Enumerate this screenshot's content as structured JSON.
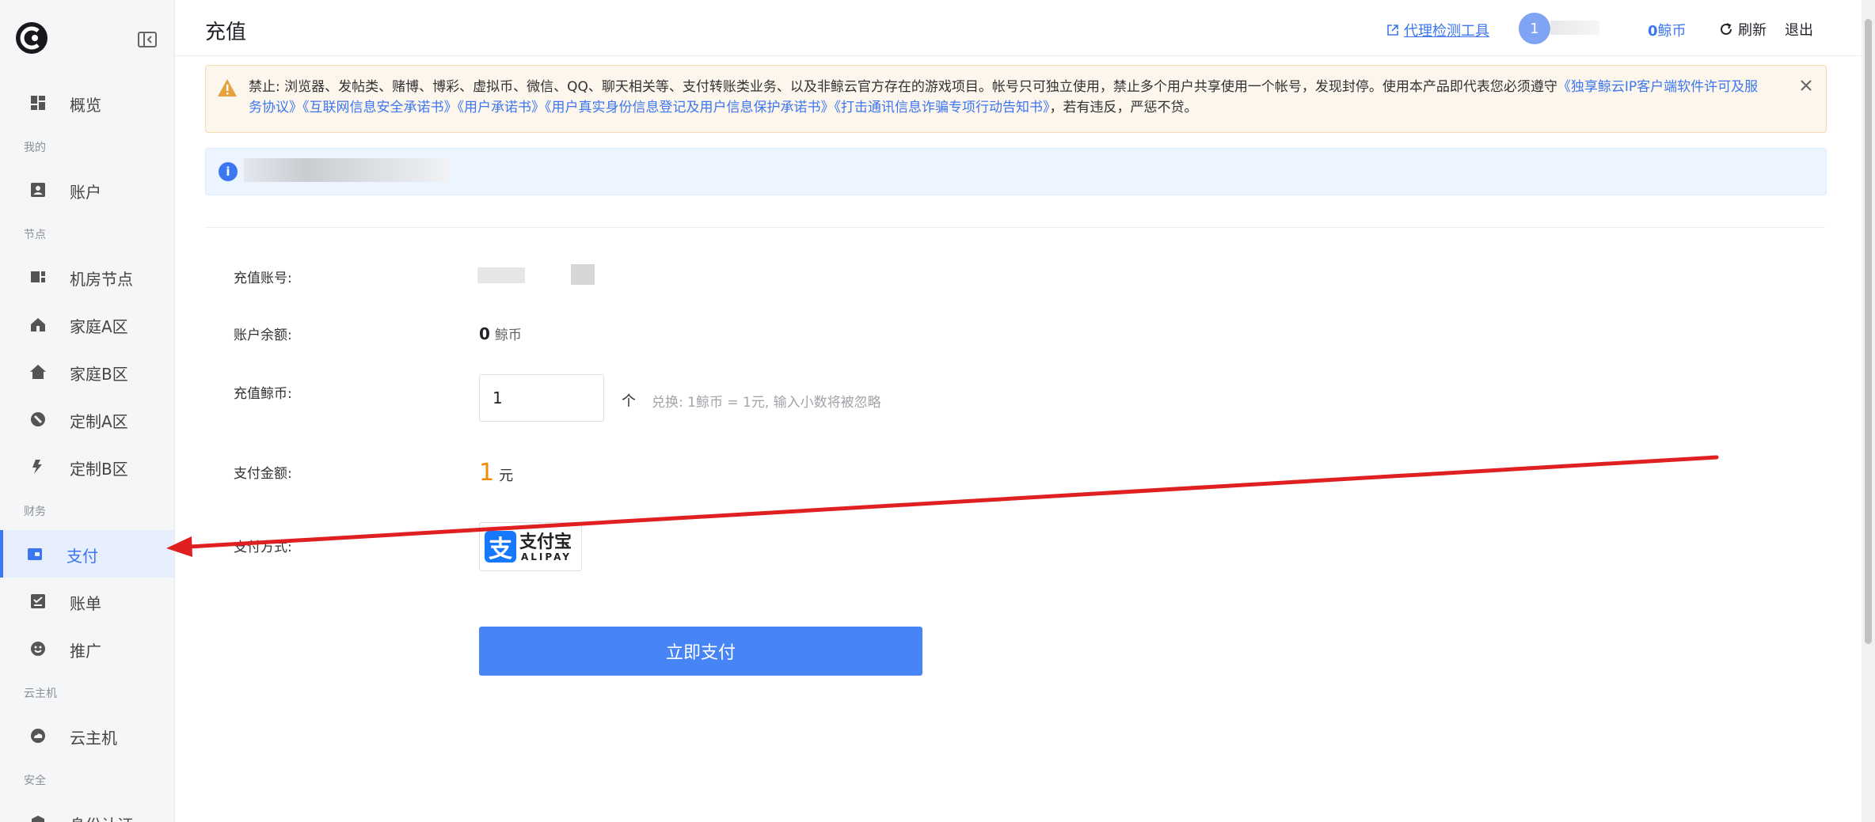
{
  "sidebar": {
    "items": [
      {
        "label": "概览",
        "icon": "dashboard-icon"
      },
      {
        "label": "账户",
        "icon": "account-icon"
      },
      {
        "label": "机房节点",
        "icon": "server-node-icon"
      },
      {
        "label": "家庭A区",
        "icon": "home-a-icon"
      },
      {
        "label": "家庭B区",
        "icon": "home-b-icon"
      },
      {
        "label": "定制A区",
        "icon": "custom-a-icon"
      },
      {
        "label": "定制B区",
        "icon": "custom-b-icon"
      },
      {
        "label": "支付",
        "icon": "wallet-icon"
      },
      {
        "label": "账单",
        "icon": "bill-icon"
      },
      {
        "label": "推广",
        "icon": "promote-icon"
      },
      {
        "label": "云主机",
        "icon": "cloud-icon"
      },
      {
        "label": "身份认证",
        "icon": "identity-icon"
      }
    ],
    "sections": [
      "我的",
      "节点",
      "财务",
      "云主机",
      "安全"
    ],
    "active_item": "支付"
  },
  "header": {
    "title": "充值",
    "proxy_tool": "代理检测工具",
    "avatar_text": "1",
    "balance_num": "0",
    "balance_unit": "鲸币",
    "refresh": "刷新",
    "logout": "退出"
  },
  "notice": {
    "text1": "禁止: 浏览器、发帖类、赌博、博彩、虚拟币、微信、QQ、聊天相关等、支付转账类业务、以及非鲸云官方存在的游戏项目。帐号只可独立使用，禁止多个用户共享使用一个帐号，发现封停。使用本产品即代表您必须遵守",
    "link1": "《独享鲸云IP客户端软件许可及服务协议》",
    "link2": "《互联网信息安全承诺书》",
    "link3": "《用户承诺书》",
    "link4": "《用户真实身份信息登记及用户信息保护承诺书》",
    "link5": "《打击通讯信息诈骗专项行动告知书》",
    "text2": "，若有违反，严惩不贷。"
  },
  "form": {
    "account_label": "充值账号:",
    "balance_label": "账户余额:",
    "balance_value": "0",
    "balance_unit": "鲸币",
    "coins_label": "充值鲸币:",
    "coins_value": "1",
    "coins_unit": "个",
    "hint": "兑换: 1鲸币 = 1元, 输入小数将被忽略",
    "pay_amount_label": "支付金额:",
    "pay_amount_value": "1",
    "pay_amount_unit": "元",
    "method_label": "支付方式:",
    "alipay_cn": "支付宝",
    "alipay_en": "ALIPAY",
    "submit": "立即支付"
  },
  "colors": {
    "accent": "#3c76f0",
    "button": "#4785f6",
    "amount": "#f08a00",
    "arrow": "#e02020"
  }
}
